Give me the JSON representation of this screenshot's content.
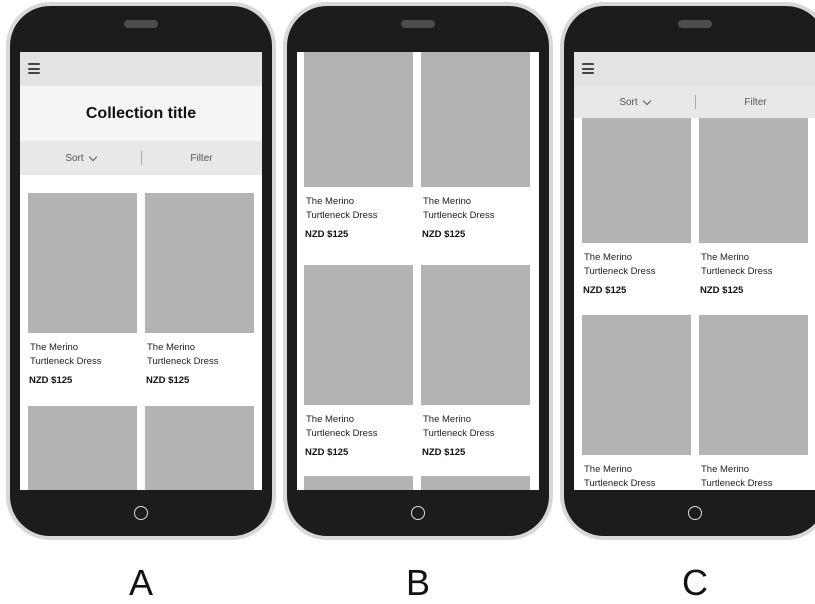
{
  "collection_title": "Collection title",
  "sort_label": "Sort",
  "filter_label": "Filter",
  "product": {
    "name_line1": "The Merino",
    "name_line2": "Turtleneck Dress",
    "price": "NZD $125"
  },
  "labels": [
    "A",
    "B",
    "C"
  ]
}
